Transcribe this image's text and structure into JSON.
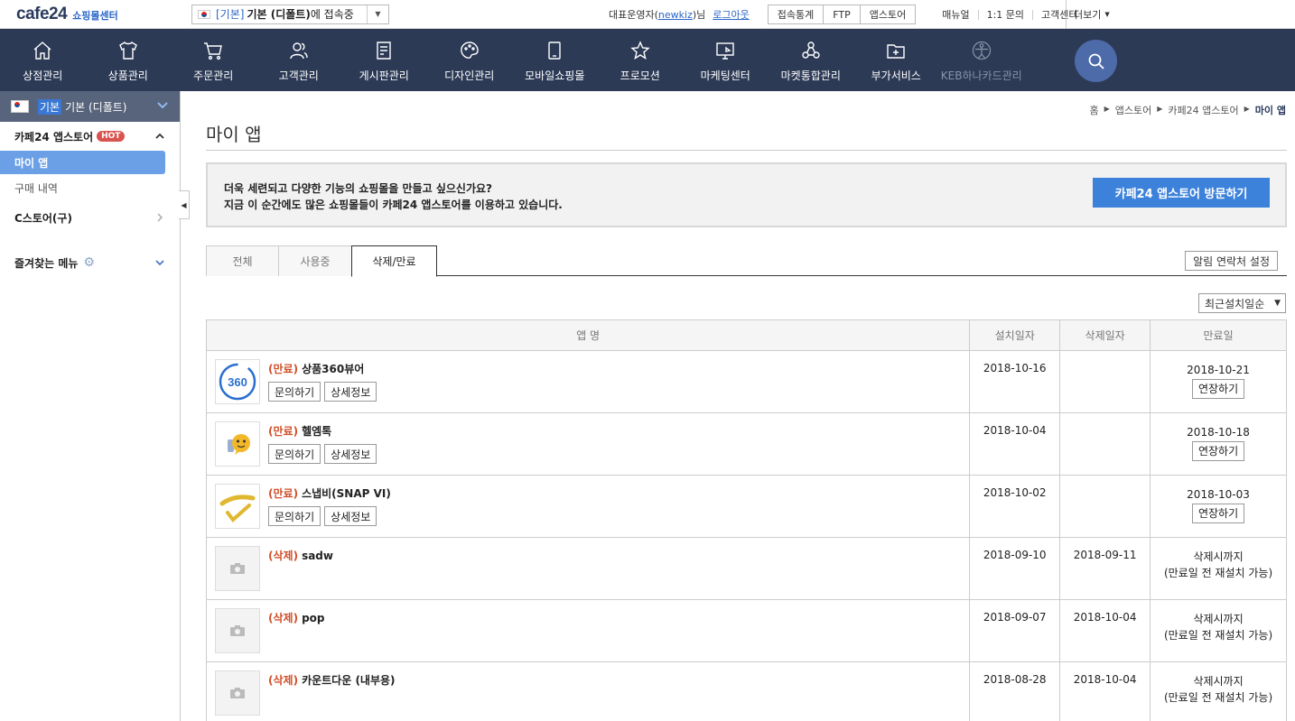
{
  "topbar": {
    "logo_main": "cafe24",
    "logo_sub": "쇼핑몰센터",
    "shop_tag": "[기본]",
    "shop_name": "기본 (디폴트)",
    "shop_suffix": "에 접속중",
    "owner_prefix": "대표운영자(",
    "owner_id": "newkiz",
    "owner_suffix": ")님",
    "logout": "로그아웃",
    "buttons": [
      "접속통계",
      "FTP",
      "앱스토어"
    ],
    "links": [
      "매뉴얼",
      "1:1 문의",
      "고객센터"
    ],
    "more": "더보기"
  },
  "nav": {
    "items": [
      {
        "label": "상점관리",
        "icon": "home-icon"
      },
      {
        "label": "상품관리",
        "icon": "shirt-icon"
      },
      {
        "label": "주문관리",
        "icon": "cart-icon"
      },
      {
        "label": "고객관리",
        "icon": "users-icon"
      },
      {
        "label": "게시판관리",
        "icon": "board-icon"
      },
      {
        "label": "디자인관리",
        "icon": "palette-icon"
      },
      {
        "label": "모바일쇼핑몰",
        "icon": "mobile-icon"
      },
      {
        "label": "프로모션",
        "icon": "star-icon"
      },
      {
        "label": "마케팅센터",
        "icon": "monitor-icon"
      },
      {
        "label": "마켓통합관리",
        "icon": "nodes-icon"
      },
      {
        "label": "부가서비스",
        "icon": "folder-plus-icon"
      },
      {
        "label": "KEB하나카드관리",
        "icon": "vitruvian-icon"
      }
    ]
  },
  "sidebar": {
    "shop_tag": "기본",
    "shop_name": "기본 (디폴트)",
    "appstore": "카페24 앱스토어",
    "hot": "HOT",
    "sub_items": [
      "마이 앱",
      "구매 내역"
    ],
    "cstore": "C스토어(구)",
    "favorites": "즐겨찾는 메뉴"
  },
  "main": {
    "breadcrumb": [
      "홈",
      "앱스토어",
      "카페24 앱스토어",
      "마이 앱"
    ],
    "title": "마이 앱",
    "promo_line1": "더욱 세련되고 다양한 기능의 쇼핑몰을 만들고 싶으신가요?",
    "promo_line2": "지금 이 순간에도 많은 쇼핑몰들이 카페24 앱스토어를 이용하고 있습니다.",
    "promo_button": "카페24 앱스토어 방문하기",
    "tabs": [
      "전체",
      "사용중",
      "삭제/만료"
    ],
    "notify_button": "알림 연락처 설정",
    "sort_value": "최근설치일순",
    "columns": [
      "앱 명",
      "설치일자",
      "삭제일자",
      "만료일"
    ],
    "btn_inquiry": "문의하기",
    "btn_detail": "상세정보",
    "btn_extend": "연장하기",
    "rows": [
      {
        "status": "(만료)",
        "name": "상품360뷰어",
        "installed": "2018-10-16",
        "deleted": "",
        "expire": "2018-10-21",
        "thumb": "icon-360"
      },
      {
        "status": "(만료)",
        "name": "헬엠톡",
        "installed": "2018-10-04",
        "deleted": "",
        "expire": "2018-10-18",
        "thumb": "icon-chat"
      },
      {
        "status": "(만료)",
        "name": "스냅비(SNAP VI)",
        "installed": "2018-10-02",
        "deleted": "",
        "expire": "2018-10-03",
        "thumb": "icon-snap"
      },
      {
        "status": "(삭제)",
        "name": "sadw",
        "installed": "2018-09-10",
        "deleted": "2018-09-11",
        "expire_line1": "삭제시까지",
        "expire_line2": "(만료일 전 재설치 가능)",
        "thumb": "placeholder"
      },
      {
        "status": "(삭제)",
        "name": "pop",
        "installed": "2018-09-07",
        "deleted": "2018-10-04",
        "expire_line1": "삭제시까지",
        "expire_line2": "(만료일 전 재설치 가능)",
        "thumb": "placeholder"
      },
      {
        "status": "(삭제)",
        "name": "카운트다운 (내부용)",
        "installed": "2018-08-28",
        "deleted": "2018-10-04",
        "expire_line1": "삭제시까지",
        "expire_line2": "(만료일 전 재설치 가능)",
        "thumb": "placeholder"
      }
    ]
  },
  "colors": {
    "nav_bg": "#2c3a56",
    "accent_blue": "#3c82db",
    "status_red": "#d2502a",
    "sidebar_active": "#6ca0e6"
  }
}
